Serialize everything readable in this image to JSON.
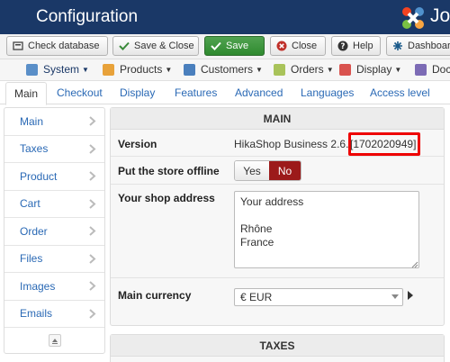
{
  "header": {
    "title": "Configuration",
    "logo_text": "Jo"
  },
  "toolbar": {
    "buttons": [
      {
        "label": "Check database",
        "icon": "database-check-icon"
      },
      {
        "label": "Save & Close",
        "icon": "checkmark-icon"
      },
      {
        "label": "Save",
        "icon": "checkmark-icon"
      },
      {
        "label": "Close",
        "icon": "close-circle-icon"
      },
      {
        "label": "Help",
        "icon": "question-circle-icon"
      },
      {
        "label": "Dashboard",
        "icon": "dashboard-icon"
      }
    ]
  },
  "menubar": {
    "items": [
      {
        "label": "System",
        "icon": "wrench-icon"
      },
      {
        "label": "Products",
        "icon": "box-icon"
      },
      {
        "label": "Customers",
        "icon": "users-icon"
      },
      {
        "label": "Orders",
        "icon": "orders-icon"
      },
      {
        "label": "Display",
        "icon": "display-icon"
      },
      {
        "label": "Doc",
        "icon": "docs-icon"
      }
    ]
  },
  "tabs": [
    "Main",
    "Checkout",
    "Display",
    "Features",
    "Advanced",
    "Languages",
    "Access level"
  ],
  "sidenav": {
    "items": [
      "Main",
      "Taxes",
      "Product",
      "Cart",
      "Order",
      "Files",
      "Images",
      "Emails"
    ]
  },
  "main_panel": {
    "heading": "MAIN",
    "version_label": "Version",
    "version_value": "HikaShop Business 2.6.",
    "version_code": "[1702020949]",
    "offline_label": "Put the store offline",
    "offline_yes": "Yes",
    "offline_no": "No",
    "address_label": "Your shop address",
    "address_value": "Your address\n\nRhône\nFrance",
    "currency_label": "Main currency",
    "currency_value": "€ EUR"
  },
  "taxes_panel": {
    "heading": "TAXES"
  },
  "colors": {
    "header_bg": "#1a3867",
    "save_green": "#3c9a3c",
    "no_active": "#9c1a1a",
    "highlight_red": "#e00000",
    "link_blue": "#2a69b5"
  }
}
